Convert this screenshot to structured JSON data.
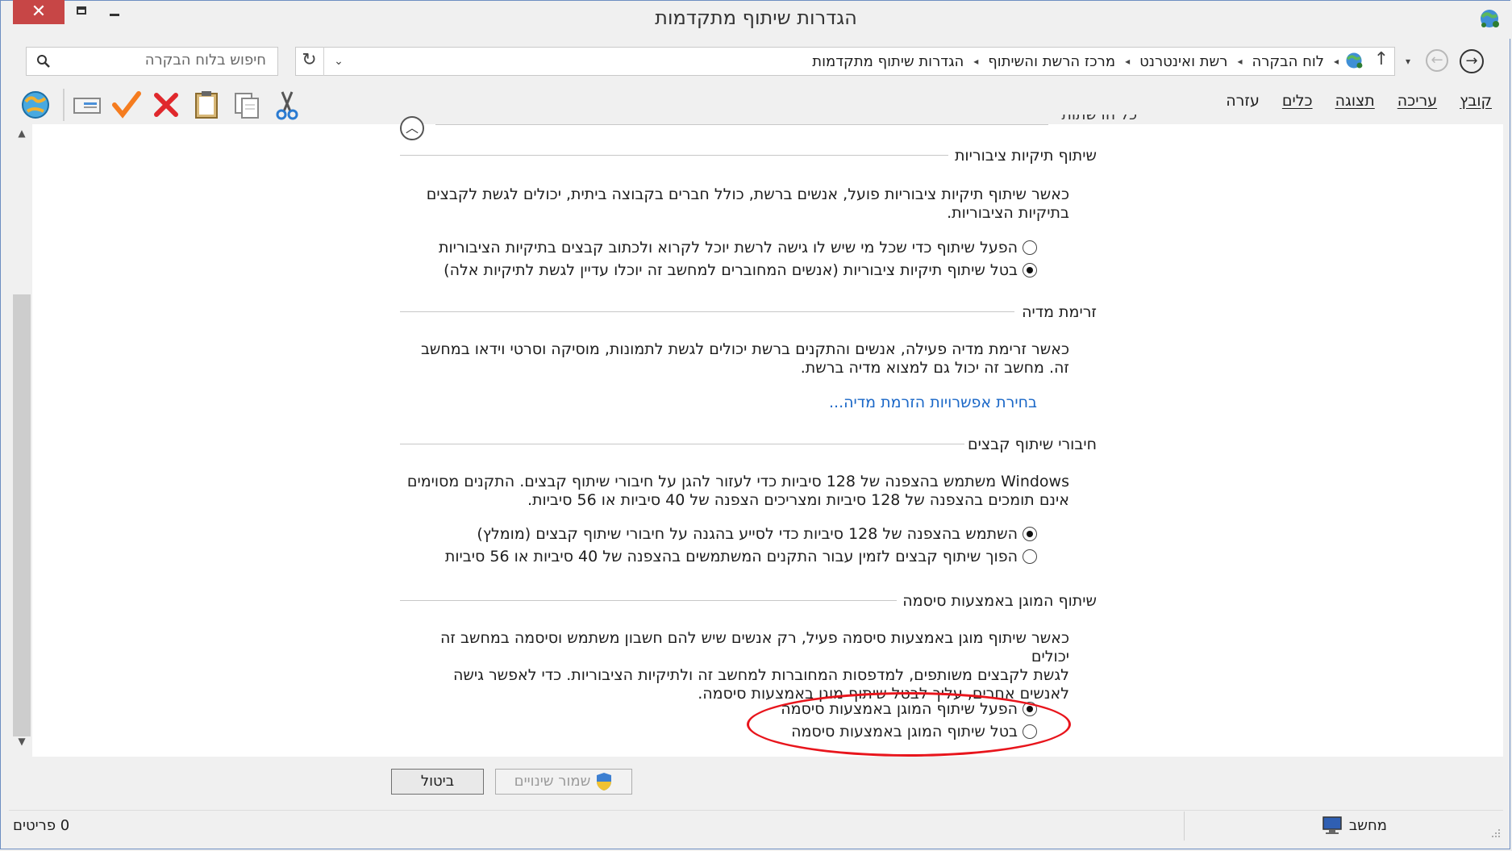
{
  "window": {
    "title": "הגדרות שיתוף מתקדמות",
    "close_glyph": "✕"
  },
  "search": {
    "placeholder": "חיפוש בלוח הבקרה"
  },
  "breadcrumb": {
    "items": [
      "לוח הבקרה",
      "רשת ואינטרנט",
      "מרכז הרשת והשיתוף",
      "הגדרות שיתוף מתקדמות"
    ],
    "separator": "◂"
  },
  "menu": {
    "items": [
      "קובץ",
      "עריכה",
      "תצוגה",
      "כלים",
      "עזרה"
    ]
  },
  "toolbar": {
    "icons": [
      "globe-icon",
      "card-icon",
      "check-icon",
      "delete-icon",
      "clipboard-icon",
      "copy-icon",
      "scissors-icon"
    ]
  },
  "content": {
    "clipped_header": "כל הרשתות",
    "public_folders": {
      "title": "שיתוף תיקיות ציבוריות",
      "desc_line1": "כאשר שיתוף תיקיות ציבוריות פועל, אנשים ברשת, כולל חברים בקבוצה ביתית, יכולים לגשת לקבצים",
      "desc_line2": "בתיקיות הציבוריות.",
      "option_on": "הפעל שיתוף כדי שכל מי שיש לו גישה לרשת יוכל לקרוא ולכתוב קבצים בתיקיות הציבוריות",
      "option_off": "בטל שיתוף תיקיות ציבוריות (אנשים המחוברים למחשב זה יוכלו עדיין לגשת לתיקיות אלה)",
      "selected": "off"
    },
    "media": {
      "title": "זרימת מדיה",
      "desc_line1": "כאשר זרימת מדיה פעילה, אנשים והתקנים ברשת יכולים לגשת לתמונות, מוסיקה וסרטי וידאו במחשב",
      "desc_line2": "זה. מחשב זה יכול גם למצוא מדיה ברשת.",
      "link": "בחירת אפשרויות הזרמת מדיה..."
    },
    "file_sharing": {
      "title": "חיבורי שיתוף קבצים",
      "desc_line1": "Windows משתמש בהצפנה של 128 סיביות כדי לעזור להגן על חיבורי שיתוף קבצים. התקנים מסוימים",
      "desc_line2": "אינם תומכים בהצפנה של 128 סיביות ומצריכים הצפנה של 40 סיביות או 56 סיביות.",
      "option_128": "השתמש בהצפנה של 128 סיביות כדי לסייע בהגנה על חיבורי שיתוף קבצים (מומלץ)",
      "option_40_56": "הפוך שיתוף קבצים לזמין עבור התקנים המשתמשים בהצפנה של 40 סיביות או 56 סיביות",
      "selected": "128"
    },
    "password": {
      "title": "שיתוף המוגן באמצעות סיסמה",
      "desc_line1": "כאשר שיתוף מוגן באמצעות סיסמה פעיל, רק אנשים שיש להם חשבון משתמש וסיסמה במחשב זה יכולים",
      "desc_line2": "לגשת לקבצים משותפים, למדפסות המחוברות למחשב זה ולתיקיות הציבוריות. כדי לאפשר גישה",
      "desc_line3": "לאנשים אחרים, עליך לבטל שיתוף מוגן באמצעות סיסמה.",
      "option_on": "הפעל שיתוף המוגן באמצעות סיסמה",
      "option_off": "בטל שיתוף המוגן באמצעות סיסמה",
      "selected": "on"
    }
  },
  "buttons": {
    "save": "שמור שינויים",
    "cancel": "ביטול"
  },
  "status": {
    "items": "0 פריטים",
    "computer": "מחשב"
  },
  "colors": {
    "link": "#1a67c7",
    "highlight": "#e8151c",
    "close": "#c74646"
  }
}
